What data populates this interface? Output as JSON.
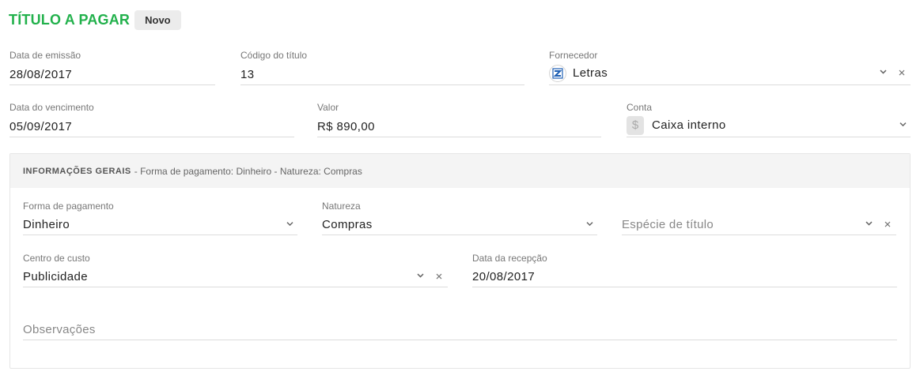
{
  "header": {
    "title": "TÍTULO A PAGAR",
    "badge": "Novo"
  },
  "fields": {
    "data_emissao": {
      "label": "Data de emissão",
      "value": "28/08/2017"
    },
    "codigo_titulo": {
      "label": "Código do título",
      "value": "13"
    },
    "fornecedor": {
      "label": "Fornecedor",
      "value": "Letras"
    },
    "data_vencimento": {
      "label": "Data do vencimento",
      "value": "05/09/2017"
    },
    "valor": {
      "label": "Valor",
      "value": "R$ 890,00"
    },
    "conta": {
      "label": "Conta",
      "value": "Caixa interno",
      "icon_glyph": "$"
    }
  },
  "panel": {
    "title": "INFORMAÇÕES GERAIS",
    "summary": "- Forma de pagamento: Dinheiro - Natureza: Compras",
    "forma_pagamento": {
      "label": "Forma de pagamento",
      "value": "Dinheiro"
    },
    "natureza": {
      "label": "Natureza",
      "value": "Compras"
    },
    "especie_titulo": {
      "placeholder": "Espécie de título"
    },
    "centro_custo": {
      "label": "Centro de custo",
      "value": "Publicidade"
    },
    "data_recepcao": {
      "label": "Data da recepção",
      "value": "20/08/2017"
    },
    "observacoes": {
      "placeholder": "Observações"
    }
  },
  "colors": {
    "title_green": "#22b14c",
    "supplier_logo_blue": "#1e5fb4"
  }
}
